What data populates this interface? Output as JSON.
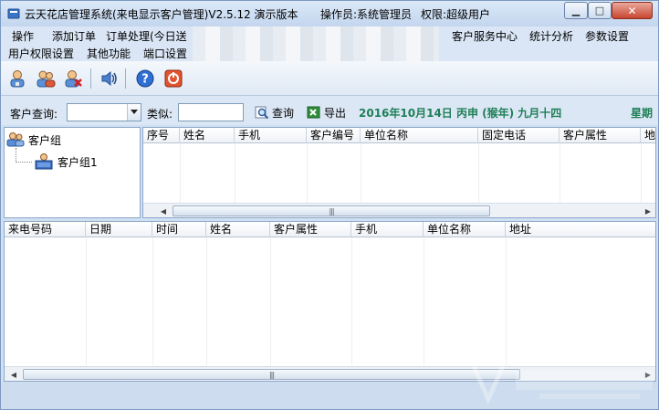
{
  "window": {
    "title": "云天花店管理系统(来电显示客户管理)V2.5.12 演示版本",
    "operator": "操作员:系统管理员",
    "permission": "权限:超级用户"
  },
  "menu": {
    "row1": [
      "操作",
      "添加订单",
      "订单处理(今日送",
      "客户服务中心",
      "统计分析",
      "参数设置"
    ],
    "row2": [
      "用户权限设置",
      "其他功能",
      "端口设置"
    ]
  },
  "toolbar": {
    "icons": [
      "user-icon",
      "users-icon",
      "user-delete-icon",
      "speaker-icon",
      "help-icon",
      "exit-icon"
    ]
  },
  "search": {
    "customer_query_label": "客户查询:",
    "customer_query_value": "",
    "similar_label": "类似:",
    "similar_value": "",
    "query_button": "查询",
    "export_button": "导出",
    "date_text": "2016年10月14日  丙申 (猴年) 九月十四",
    "weekday_text": "星期"
  },
  "tree": {
    "root": "客户组",
    "children": [
      "客户组1"
    ]
  },
  "customer_grid": {
    "columns": [
      "序号",
      "姓名",
      "手机",
      "客户编号",
      "单位名称",
      "固定电话",
      "客户属性",
      "地"
    ]
  },
  "call_grid": {
    "columns": [
      "来电号码",
      "日期",
      "时间",
      "姓名",
      "客户属性",
      "手机",
      "单位名称",
      "地址"
    ]
  },
  "colors": {
    "accent_green": "#1f7f57",
    "window_bg": "#cfe0f3"
  }
}
